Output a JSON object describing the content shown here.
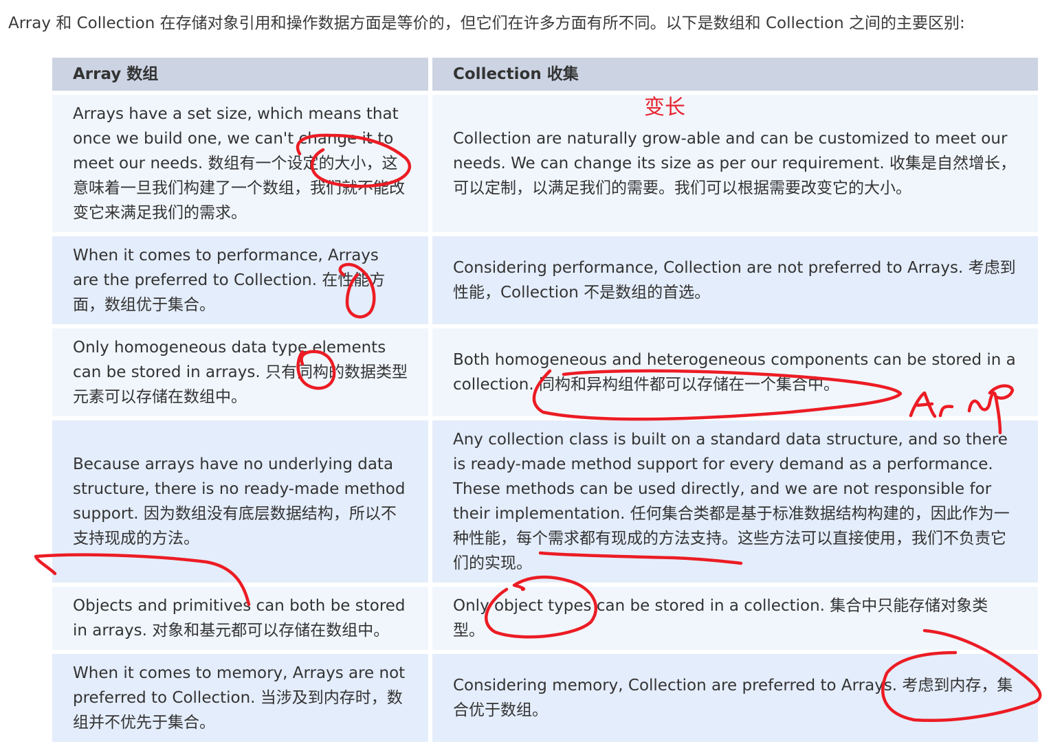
{
  "intro": "Array 和 Collection 在存储对象引用和操作数据方面是等价的，但它们在许多方面有所不同。以下是数组和 Collection 之间的主要区别:",
  "table": {
    "headers": [
      "Array  数组",
      "Collection  收集"
    ],
    "rows": [
      {
        "array": "Arrays have a set size, which means that once we build one, we can't change it to meet our needs. 数组有一个设定的大小，这意味着一旦我们构建了一个数组，我们就不能改变它来满足我们的需求。",
        "collection": "Collection are naturally grow-able and can be customized to meet our needs. We can change its size as per our requirement. 收集是自然增长，可以定制，以满足我们的需要。我们可以根据需要改变它的大小。"
      },
      {
        "array": "When it comes to performance, Arrays are the preferred to Collection. 在性能方面，数组优于集合。",
        "collection": "Considering performance, Collection are not preferred to Arrays. 考虑到性能，Collection 不是数组的首选。"
      },
      {
        "array": "Only homogeneous data type elements can be stored in arrays. 只有同构的数据类型元素可以存储在数组中。",
        "collection": "Both homogeneous and heterogeneous components can be stored in a collection. 同构和异构组件都可以存储在一个集合中。"
      },
      {
        "array": "Because arrays have no underlying data structure, there is no ready-made method support. 因为数组没有底层数据结构，所以不支持现成的方法。",
        "collection": "Any collection class is built on a standard data structure, and so there is ready-made method support for every demand as a performance. These methods can be used directly, and we are not responsible for their implementation. 任何集合类都是基于标准数据结构构建的，因此作为一种性能，每个需求都有现成的方法支持。这些方法可以直接使用，我们不负责它们的实现。"
      },
      {
        "array": "Objects and primitives can both be stored in arrays. 对象和基元都可以存储在数组中。",
        "collection": "Only object types can be stored in a collection. 集合中只能存储对象类型。"
      },
      {
        "array": "When it comes to memory, Arrays are not preferred to Collection. 当涉及到内存时，数组并不优先于集合。",
        "collection": "Considering memory, Collection are preferred to Arrays. 考虑到内存，集合优于数组。"
      }
    ]
  },
  "annotations": {
    "handwritten_note": "变长",
    "ink_color": "#ec1c24"
  }
}
